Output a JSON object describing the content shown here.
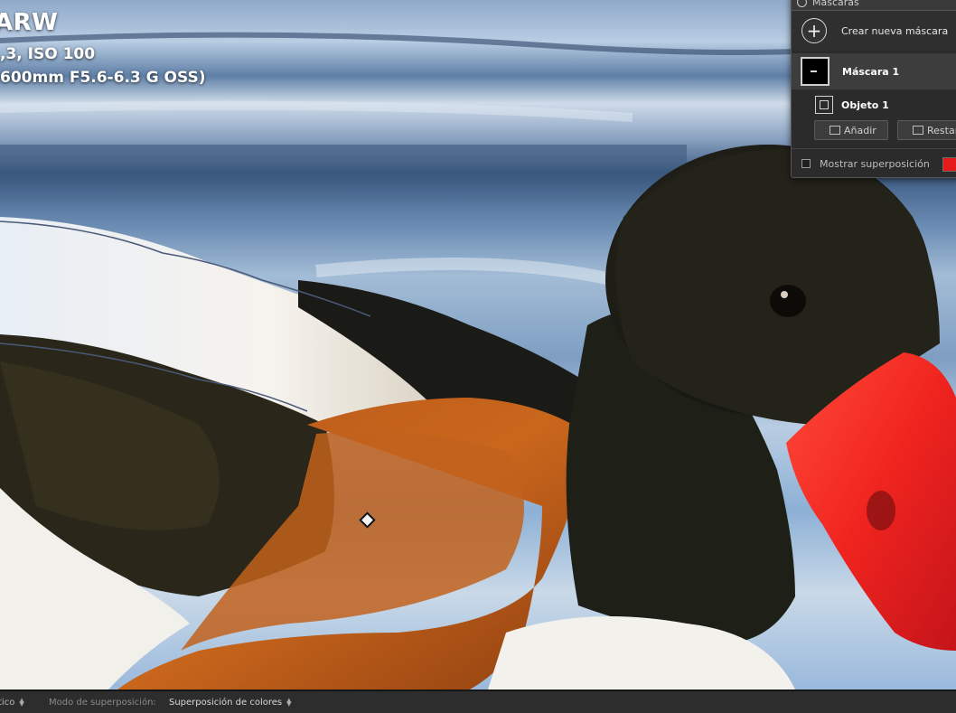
{
  "photo_info": {
    "file_name": "ARW",
    "exposure": ",3, ISO 100",
    "lens": "600mm F5.6-6.3 G OSS)"
  },
  "masks_panel": {
    "header_title": "Máscaras",
    "create_label": "Crear nueva máscara",
    "mask_name": "Máscara 1",
    "object_name": "Objeto 1",
    "add_label": "Añadir",
    "subtract_label": "Restar",
    "show_overlay_label": "Mostrar superposición",
    "overlay_color": "#e51b1b"
  },
  "toolbar": {
    "auto_mode_value": "tico",
    "overlay_mode_label": "Modo de superposición:",
    "overlay_mode_value": "Superposición de colores"
  }
}
